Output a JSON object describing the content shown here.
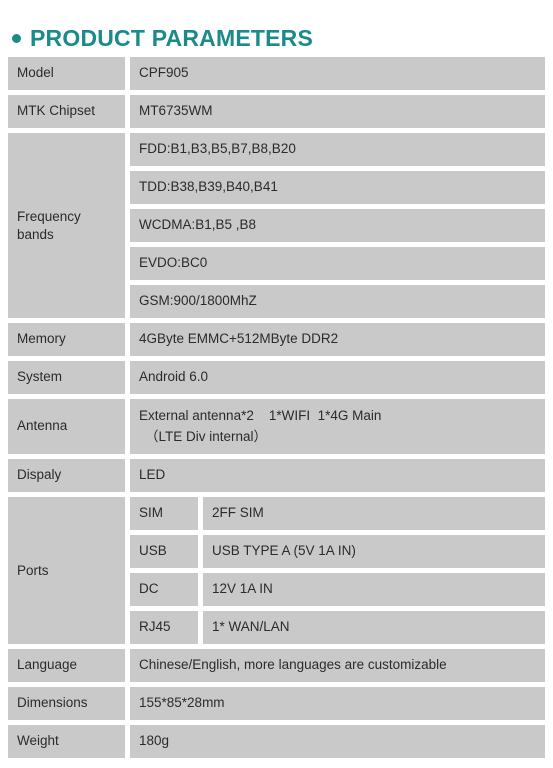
{
  "header": {
    "bullet_icon": "bullet-dot-icon",
    "title": "PRODUCT PARAMETERS",
    "accent_color": "#1a8a8a"
  },
  "table": {
    "cell_background": "#c9c9c9",
    "text_color": "#2b2b2b",
    "rows": [
      {
        "label": "Model",
        "value": "CPF905"
      },
      {
        "label": "MTK Chipset",
        "value": "MT6735WM"
      },
      {
        "label": "Frequency bands",
        "label_line1": "Frequency",
        "label_line2": "bands",
        "subrows": [
          {
            "value": "FDD:B1,B3,B5,B7,B8,B20"
          },
          {
            "value": "TDD:B38,B39,B40,B41"
          },
          {
            "value": "WCDMA:B1,B5 ,B8"
          },
          {
            "value": "EVDO:BC0"
          },
          {
            "value": "GSM:900/1800MhZ"
          }
        ]
      },
      {
        "label": "Memory",
        "value": "4GByte EMMC+512MByte DDR2"
      },
      {
        "label": "System",
        "value": "Android 6.0"
      },
      {
        "label": "Antenna",
        "value_line1": "External antenna*2    1*WIFI  1*4G Main",
        "value_line2": "（LTE Div internal）"
      },
      {
        "label": "Dispaly",
        "value": "LED"
      },
      {
        "label": "Ports",
        "subrows": [
          {
            "sub_label": "SIM",
            "value": "2FF SIM"
          },
          {
            "sub_label": "USB",
            "value": "USB TYPE A (5V 1A IN)"
          },
          {
            "sub_label": "DC",
            "value": "12V  1A IN"
          },
          {
            "sub_label": "RJ45",
            "value": "1* WAN/LAN"
          }
        ]
      },
      {
        "label": "Language",
        "value": "Chinese/English, more languages are customizable"
      },
      {
        "label": "Dimensions",
        "value": "155*85*28mm"
      },
      {
        "label": "Weight",
        "value": "180g"
      }
    ]
  }
}
